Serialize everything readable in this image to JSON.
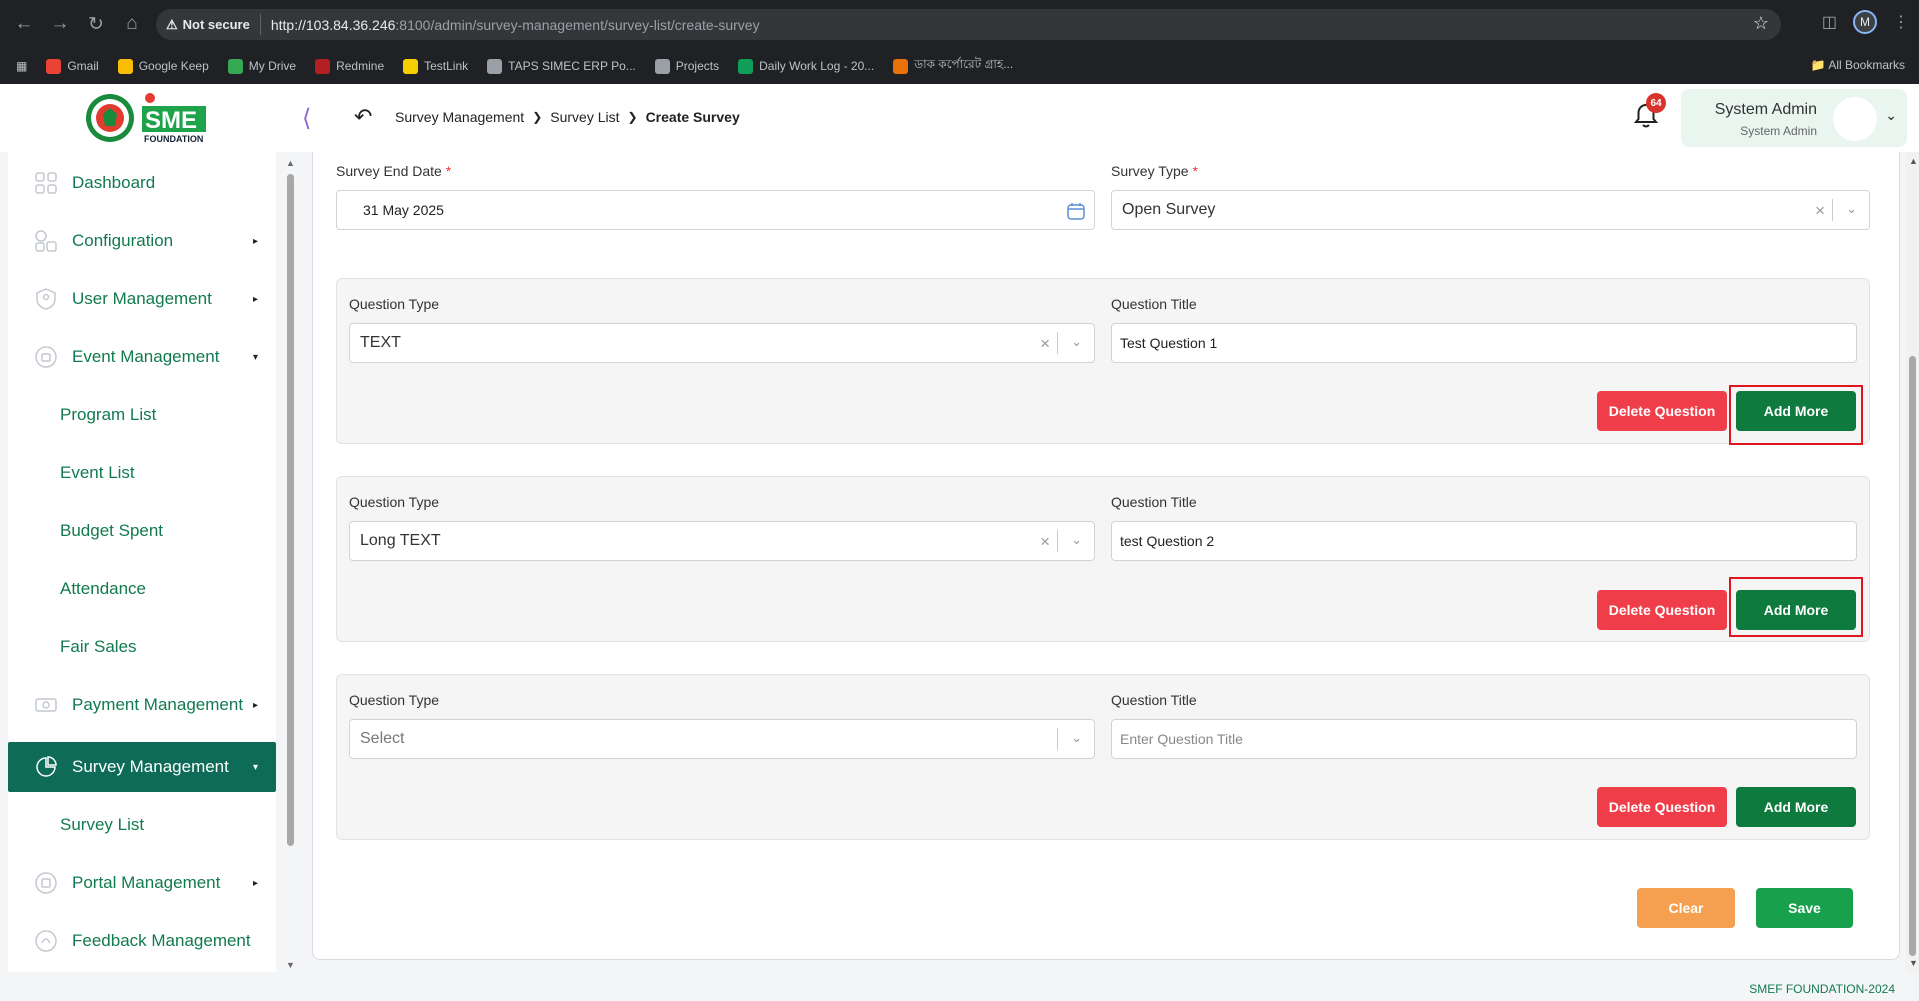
{
  "browser": {
    "not_secure": "Not secure",
    "url_host": "http://103.84.36.246",
    "url_path": ":8100/admin/survey-management/survey-list/create-survey",
    "profile_initial": "M",
    "bookmarks": [
      {
        "label": "Gmail",
        "color": "#ea4335"
      },
      {
        "label": "Google Keep",
        "color": "#fbbc04"
      },
      {
        "label": "My Drive",
        "color": "#34a853"
      },
      {
        "label": "Redmine",
        "color": "#b32024"
      },
      {
        "label": "TestLink",
        "color": "#f5d000"
      },
      {
        "label": "TAPS SIMEC ERP Po...",
        "color": "#9aa0a6"
      },
      {
        "label": "Projects",
        "color": "#9aa0a6"
      },
      {
        "label": "Daily Work Log - 20...",
        "color": "#0f9d58"
      },
      {
        "label": "ডাক কর্পোরেট গ্রাহ...",
        "color": "#e8710a"
      }
    ],
    "all_bookmarks": "All Bookmarks"
  },
  "header": {
    "logo_text": "SME",
    "logo_sub": "FOUNDATION",
    "breadcrumb": [
      "Survey Management",
      "Survey List",
      "Create Survey"
    ],
    "notification_count": "64",
    "user_name": "System Admin",
    "user_role": "System Admin"
  },
  "sidebar": {
    "items": [
      {
        "label": "Dashboard"
      },
      {
        "label": "Configuration"
      },
      {
        "label": "User Management"
      },
      {
        "label": "Event Management"
      },
      {
        "label": "Program List"
      },
      {
        "label": "Event List"
      },
      {
        "label": "Budget Spent"
      },
      {
        "label": "Attendance"
      },
      {
        "label": "Fair Sales"
      },
      {
        "label": "Payment Management"
      },
      {
        "label": "Survey Management"
      },
      {
        "label": "Survey List"
      },
      {
        "label": "Portal Management"
      },
      {
        "label": "Feedback Management"
      }
    ]
  },
  "form": {
    "end_date_label": "Survey End Date",
    "end_date_value": "31 May 2025",
    "survey_type_label": "Survey Type",
    "survey_type_value": "Open Survey",
    "required_mark": "*",
    "question_type_label": "Question Type",
    "question_title_label": "Question Title",
    "questions": [
      {
        "type": "TEXT",
        "title": "Test Question 1"
      },
      {
        "type": "Long TEXT",
        "title": "test Question 2"
      },
      {
        "type_placeholder": "Select",
        "title_placeholder": "Enter Question Title"
      }
    ],
    "delete_label": "Delete Question",
    "add_more_label": "Add More",
    "clear_label": "Clear",
    "save_label": "Save"
  },
  "footer": {
    "text": "SMEF FOUNDATION-2024"
  }
}
